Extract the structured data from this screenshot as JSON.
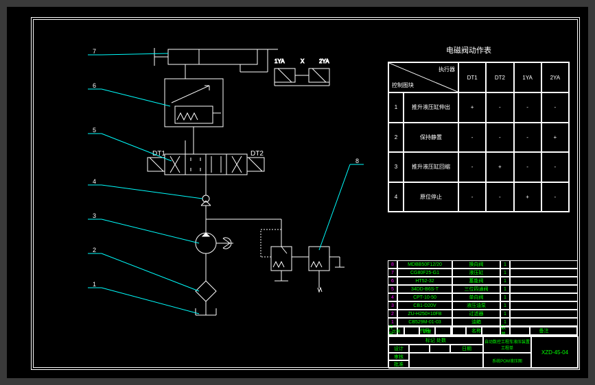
{
  "labels": {
    "dt1": "DT1",
    "dt2": "DT2"
  },
  "callouts": [
    "1",
    "2",
    "3",
    "4",
    "5",
    "6",
    "7",
    "8"
  ],
  "action_table": {
    "title": "电磁阀动作表",
    "header": [
      "执行器",
      "控制图块",
      "DT1",
      "DT2",
      "1YA",
      "2YA"
    ],
    "rows": [
      {
        "num": "1",
        "label": "推升液压缸伸出",
        "vals": [
          "+",
          "-",
          "-",
          "-"
        ]
      },
      {
        "num": "2",
        "label": "保持静置",
        "vals": [
          "-",
          "-",
          "-",
          "+"
        ]
      },
      {
        "num": "3",
        "label": "推升液压缸回缩",
        "vals": [
          "-",
          "+",
          "-",
          "-"
        ]
      },
      {
        "num": "4",
        "label": "原位停止",
        "vals": [
          "-",
          "-",
          "+",
          "-"
        ]
      }
    ]
  },
  "parts_list": {
    "header": [
      "件号",
      "代号",
      "名称",
      "数量",
      "备注"
    ],
    "rows": [
      {
        "num": "8",
        "code": "MDBB50F12/20",
        "name": "换向阀",
        "qty": "1"
      },
      {
        "num": "7",
        "code": "CG80F25-G1",
        "name": "液压缸",
        "qty": "1"
      },
      {
        "num": "6",
        "code": "HT52-32",
        "name": "蓄能阀",
        "qty": "1"
      },
      {
        "num": "5",
        "code": "34DD-B6S-T",
        "name": "三位四通阀",
        "qty": "1"
      },
      {
        "num": "4",
        "code": "CPT-10-50",
        "name": "单向阀",
        "qty": "1"
      },
      {
        "num": "3",
        "code": "CB1-D20V",
        "name": "液压油泵",
        "qty": "1"
      },
      {
        "num": "2",
        "code": "ZU-H250×10FB",
        "name": "过滤器",
        "qty": "1"
      },
      {
        "num": "1",
        "code": "CB529M-01-03",
        "name": "油箱",
        "qty": "1"
      }
    ]
  },
  "title_block": {
    "project": "自动数控工程车液压装置工程单",
    "drawing": "系统POM液压图",
    "code": "XZD-45-04",
    "scale_label": "比例",
    "mass_label": "质量",
    "check": "标记 处数",
    "designer": "设计",
    "audit": "审核",
    "approve": "批准",
    "date": "日期"
  }
}
